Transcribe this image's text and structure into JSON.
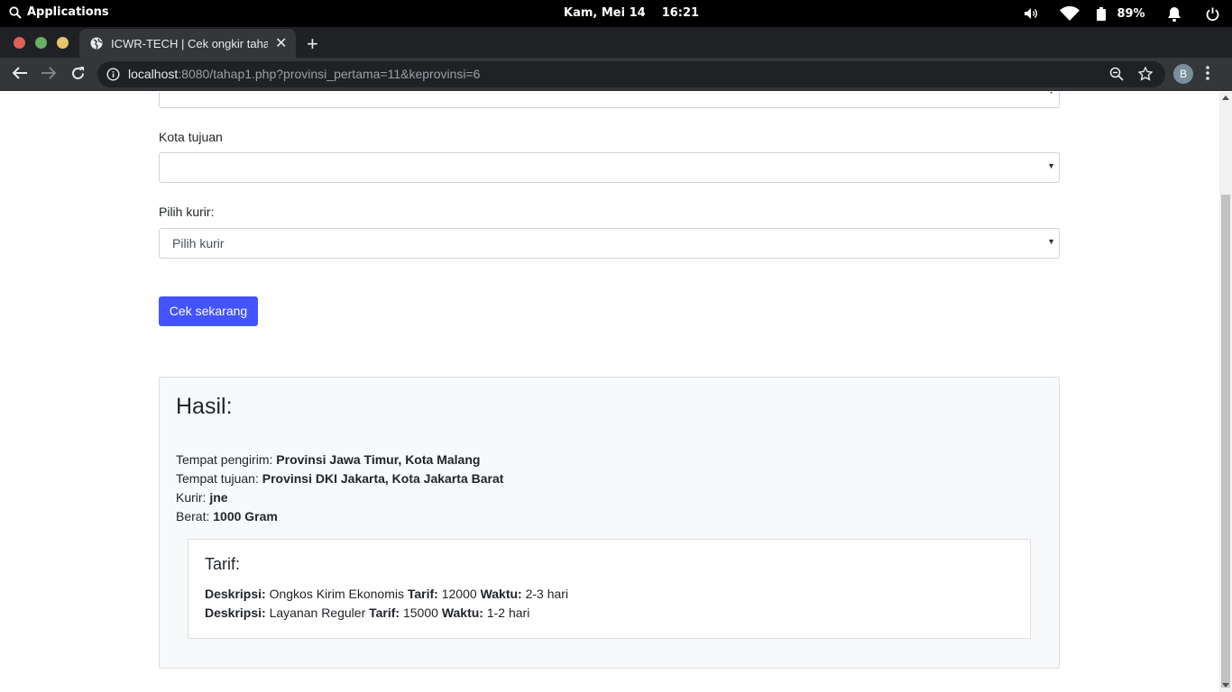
{
  "system_bar": {
    "applications_label": "Applications",
    "date": "Kam, Mei 14",
    "time": "16:21",
    "battery": "89%"
  },
  "browser": {
    "tab_title": "ICWR-TECH | Cek ongkir tahap",
    "url_host": "localhost",
    "url_rest": ":8080/tahap1.php?provinsi_pertama=11&keprovinsi=6",
    "profile_initial": "B"
  },
  "form": {
    "kota_tujuan_label": "Kota tujuan",
    "kota_tujuan_value": "",
    "kurir_label": "Pilih kurir:",
    "kurir_value": "Pilih kurir",
    "submit_label": "Cek sekarang"
  },
  "result": {
    "heading": "Hasil:",
    "pengirim_label": "Tempat pengirim:",
    "pengirim_value": "Provinsi Jawa Timur, Kota Malang",
    "tujuan_label": "Tempat tujuan:",
    "tujuan_value": "Provinsi DKI Jakarta, Kota Jakarta Barat",
    "kurir_label": "Kurir:",
    "kurir_value": "jne",
    "berat_label": "Berat:",
    "berat_value": "1000 Gram",
    "tarif_heading": "Tarif:",
    "tarif_rows": [
      {
        "desc_label": "Deskripsi:",
        "desc": "Ongkos Kirim Ekonomis",
        "tarif_label": "Tarif:",
        "tarif": "12000",
        "waktu_label": "Waktu:",
        "waktu": "2-3 hari"
      },
      {
        "desc_label": "Deskripsi:",
        "desc": "Layanan Reguler",
        "tarif_label": "Tarif:",
        "tarif": "15000",
        "waktu_label": "Waktu:",
        "waktu": "1-2 hari"
      }
    ]
  },
  "colors": {
    "button": "#4353ff",
    "result_bg": "#f8f9fa"
  }
}
